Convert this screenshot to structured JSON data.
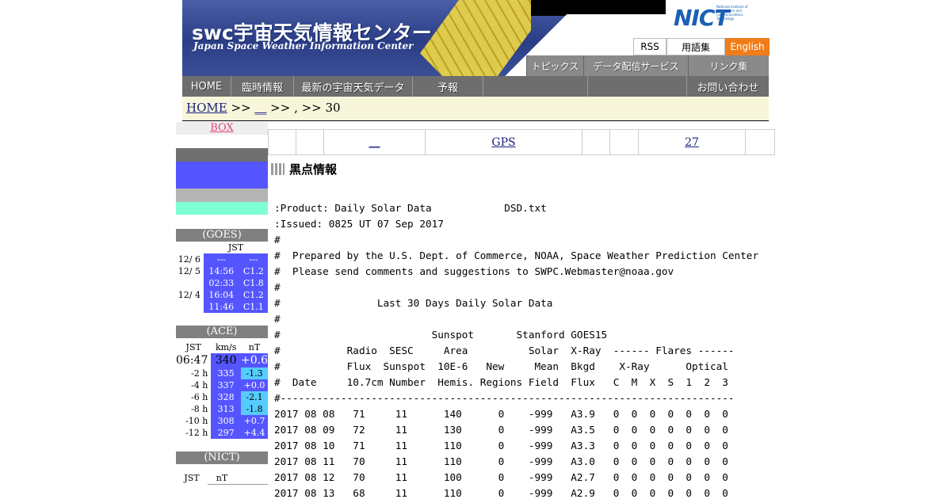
{
  "header": {
    "logo_ja": "swc宇宙天気情報センター",
    "logo_en": "Japan Space Weather Information Center",
    "nict": "NICT",
    "nict_small": "National Institute of Information and Communications Technology",
    "rss": "RSS",
    "glossary": "用語集",
    "english": "English",
    "subnav": [
      "トピックス",
      "データ配信サービス",
      "リンク集"
    ]
  },
  "nav": [
    "HOME",
    "臨時情報",
    "最新の宇宙天気データ",
    "予報",
    "",
    "",
    "お問い合わせ"
  ],
  "breadcrumb": {
    "home": "HOME",
    "sep1": ">>",
    "link2": "__",
    "rest": ">> , >> 30"
  },
  "linkrow": [
    "",
    "",
    "__",
    "GPS",
    "",
    "",
    "27",
    ""
  ],
  "section_title": "黒点情報",
  "sidebar": {
    "box": "BOX",
    "goes": {
      "head": "(GOES)",
      "col": "JST",
      "rows": [
        {
          "date": "12/ 6",
          "time": "---",
          "val": "---"
        },
        {
          "date": "12/ 5",
          "time": "14:56",
          "val": "C1.2"
        },
        {
          "date": "",
          "time": "02:33",
          "val": "C1.8"
        },
        {
          "date": "12/ 4",
          "time": "16:04",
          "val": "C1.2"
        },
        {
          "date": "",
          "time": "11:46",
          "val": "C1.1"
        }
      ]
    },
    "ace": {
      "head": "(ACE)",
      "cols": [
        "JST",
        "km/s",
        "nT"
      ],
      "now": {
        "label": "06:47",
        "speed": "340",
        "bz": "+0.6"
      },
      "rows": [
        {
          "label": "-2 h",
          "speed": "335",
          "bz": "-1.3"
        },
        {
          "label": "-4 h",
          "speed": "337",
          "bz": "+0.0"
        },
        {
          "label": "-6 h",
          "speed": "328",
          "bz": "-2.1"
        },
        {
          "label": "-8 h",
          "speed": "313",
          "bz": "-1.8"
        },
        {
          "label": "-10 h",
          "speed": "308",
          "bz": "+0.7"
        },
        {
          "label": "-12 h",
          "speed": "297",
          "bz": "+4.4"
        }
      ]
    },
    "nict": {
      "head": "(NICT)",
      "cols": [
        "JST",
        "nT"
      ]
    }
  },
  "report": [
    ":Product: Daily Solar Data            DSD.txt",
    ":Issued: 0825 UT 07 Sep 2017",
    "#",
    "#  Prepared by the U.S. Dept. of Commerce, NOAA, Space Weather Prediction Center",
    "#  Please send comments and suggestions to SWPC.Webmaster@noaa.gov",
    "#",
    "#                Last 30 Days Daily Solar Data",
    "#",
    "#                         Sunspot       Stanford GOES15",
    "#           Radio  SESC     Area          Solar  X-Ray  ------ Flares ------",
    "#           Flux  Sunspot  10E-6   New     Mean  Bkgd    X-Ray      Optical",
    "#  Date     10.7cm Number  Hemis. Regions Field  Flux   C  M  X  S  1  2  3",
    "#---------------------------------------------------------------------------",
    "2017 08 08   71     11      140      0    -999   A3.9   0  0  0  0  0  0  0",
    "2017 08 09   72     11      130      0    -999   A3.5   0  0  0  0  0  0  0",
    "2017 08 10   71     11      110      0    -999   A3.3   0  0  0  0  0  0  0",
    "2017 08 11   70     11      110      0    -999   A3.0   0  0  0  0  0  0  0",
    "2017 08 12   70     11      100      0    -999   A2.7   0  0  0  0  0  0  0",
    "2017 08 13   68     11      110      0    -999   A2.9   0  0  0  0  0  0  0"
  ],
  "colors": {
    "banner": "#2a3d85",
    "english_btn": "#f07d1a",
    "nav": "#6e6e6e",
    "breadcrumb_bg": "#f8f6da",
    "sidebar_blue": "#5555ff",
    "sidebar_cyan": "#55ccff",
    "sidebar_mint": "#7fffd4"
  }
}
